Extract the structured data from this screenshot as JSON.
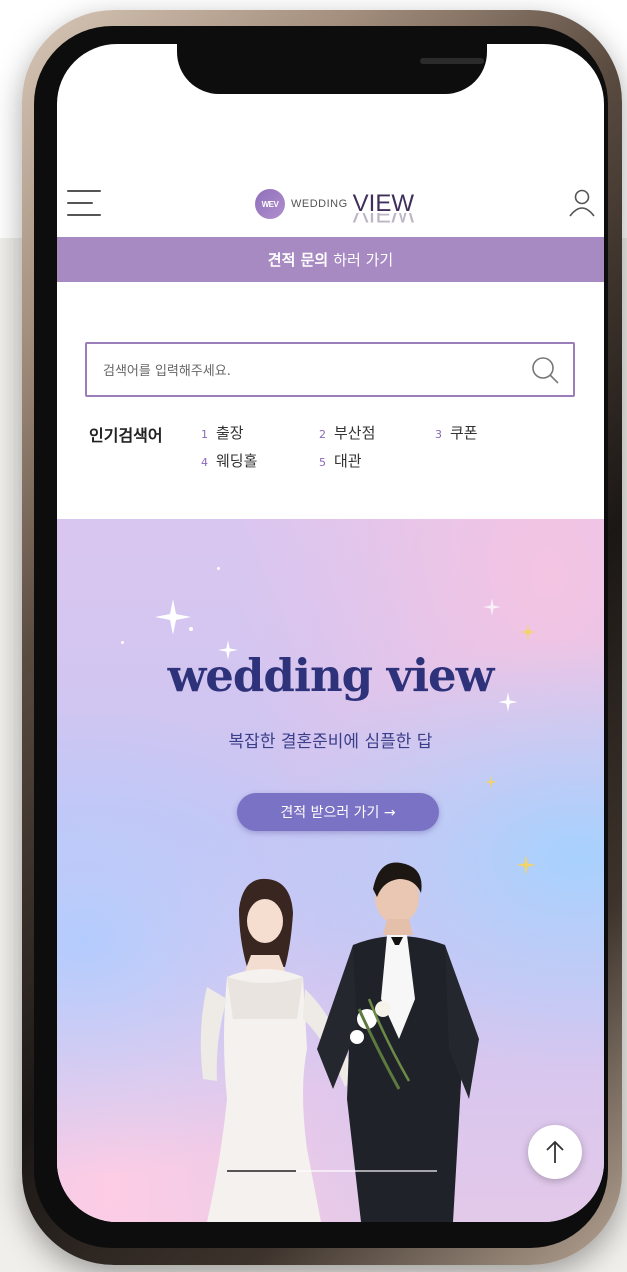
{
  "header": {
    "logo_mark": "WEV",
    "logo_wedding": "WEDDING",
    "logo_view": "VIEW"
  },
  "quote_banner": {
    "bold": "견적 문의",
    "rest": "하러 가기",
    "color": "#a78ac2"
  },
  "search": {
    "placeholder": "검색어를 입력해주세요."
  },
  "popular": {
    "title": "인기검색어",
    "items": [
      {
        "num": "1",
        "label": "출장"
      },
      {
        "num": "2",
        "label": "부산점"
      },
      {
        "num": "3",
        "label": "쿠폰"
      },
      {
        "num": "4",
        "label": "웨딩홀"
      },
      {
        "num": "5",
        "label": "대관"
      }
    ]
  },
  "hero": {
    "title": "wedding view",
    "subtitle": "복잡한 결혼준비에 심플한 답",
    "button": "견적 받으러 가기 →",
    "slide_progress": 0.33
  },
  "icons": {
    "menu": "hamburger-icon",
    "user": "user-icon",
    "search": "search-icon",
    "scroll_top": "arrow-up-icon"
  },
  "colors": {
    "accent": "#9b7db9",
    "title": "#2e327a",
    "button": "#7a72c4"
  }
}
